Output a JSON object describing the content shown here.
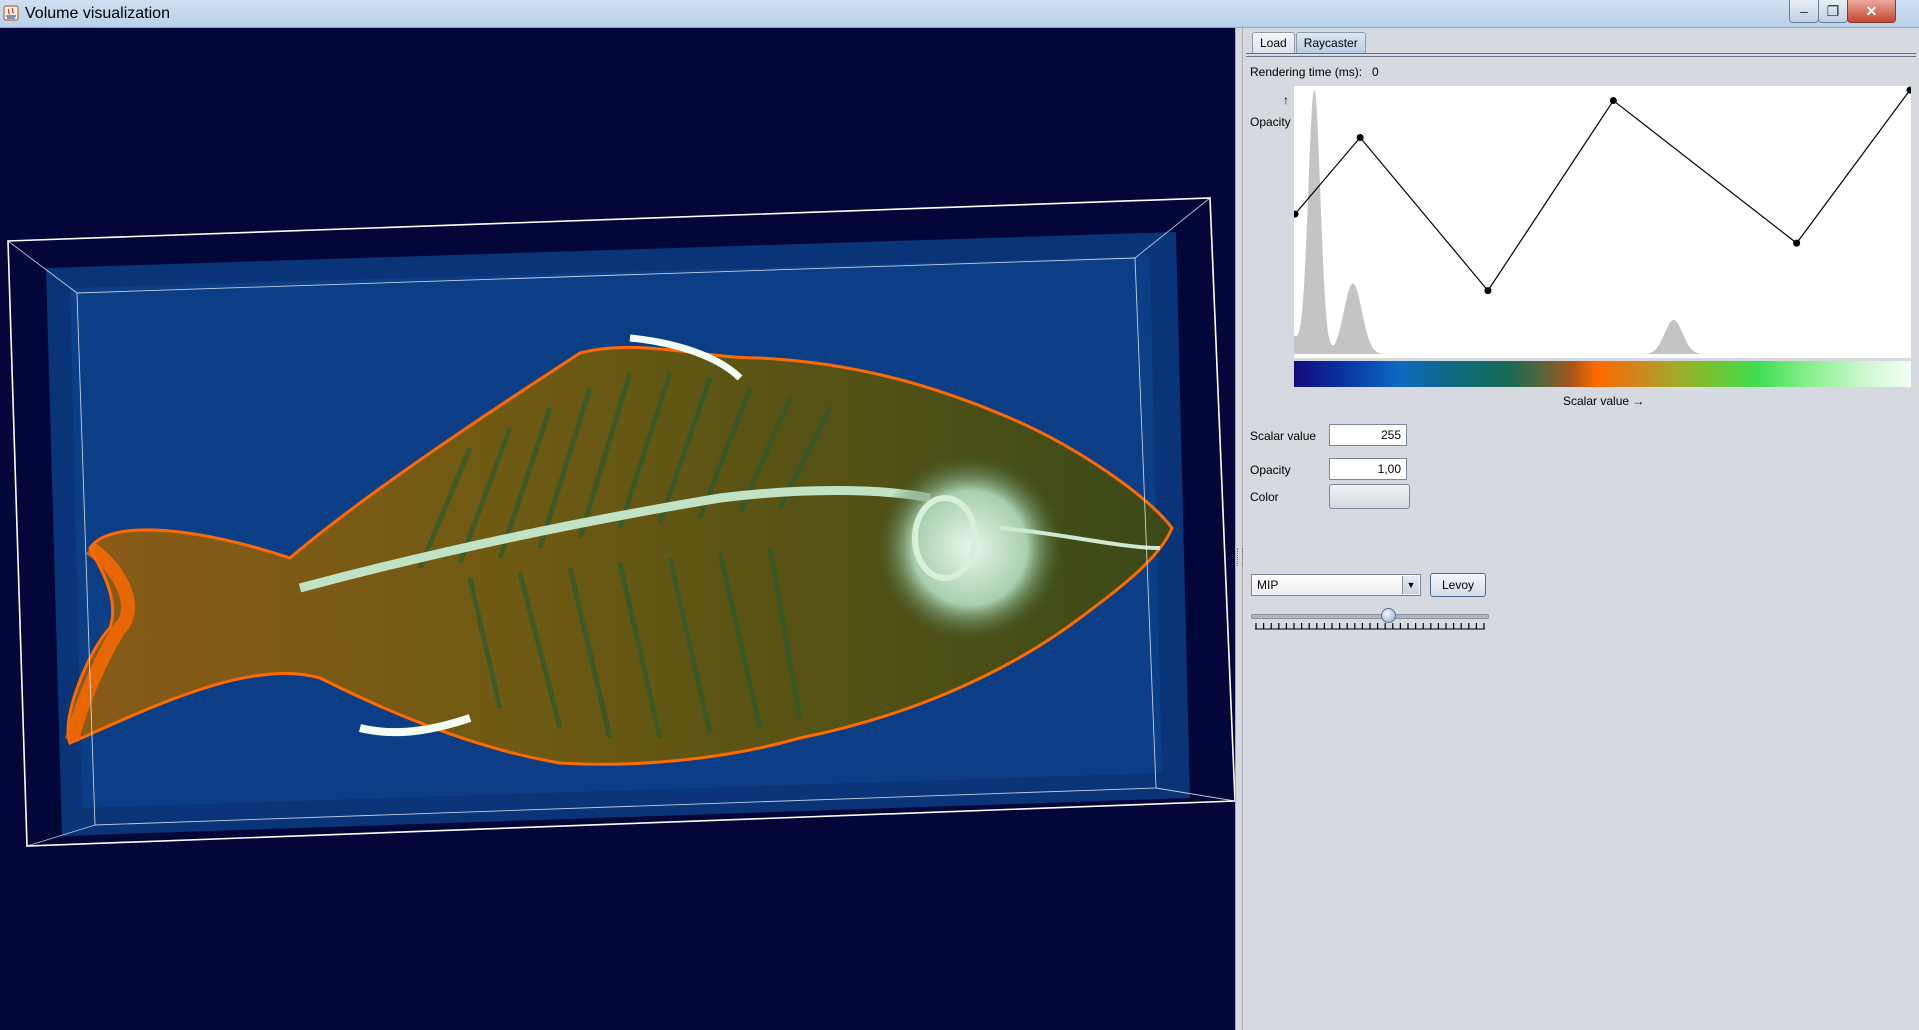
{
  "window": {
    "title": "Volume visualization",
    "controls": {
      "minimize": "–",
      "maximize": "❐",
      "close": "✕"
    }
  },
  "view": {
    "background_color": "#030638",
    "colors": {
      "volume_blue": "#0a3f86",
      "fish_body": "#7a5a10",
      "fish_edge": "#ff6a00",
      "bone": "#c9e6d2",
      "bounding_box": "#ffffff"
    }
  },
  "tabs": [
    {
      "label": "Load",
      "active": false
    },
    {
      "label": "Raycaster",
      "active": true
    }
  ],
  "raycaster": {
    "rendering_time_label": "Rendering time (ms):",
    "rendering_time_value": "0",
    "opacity_arrow": "↑",
    "opacity_axis_label": "Opacity",
    "scalar_axis_label": "Scalar value →",
    "transfer_function": {
      "control_points": [
        {
          "scalar": 0,
          "opacity": 0.53
        },
        {
          "scalar": 27,
          "opacity": 0.82
        },
        {
          "scalar": 80,
          "opacity": 0.24
        },
        {
          "scalar": 132,
          "opacity": 0.96
        },
        {
          "scalar": 208,
          "opacity": 0.42
        },
        {
          "scalar": 255,
          "opacity": 1.0
        }
      ],
      "histogram_peaks": [
        {
          "scalar": 8,
          "height": 1.0
        },
        {
          "scalar": 24,
          "height": 0.27
        },
        {
          "scalar": 157,
          "height": 0.13
        }
      ]
    },
    "scalar_value_label": "Scalar value",
    "scalar_value": "255",
    "opacity_label": "Opacity",
    "opacity_value": "1,00",
    "color_label": "Color",
    "render_method": "MIP",
    "levoy_button": "Levoy",
    "slider_fraction": 0.58
  }
}
